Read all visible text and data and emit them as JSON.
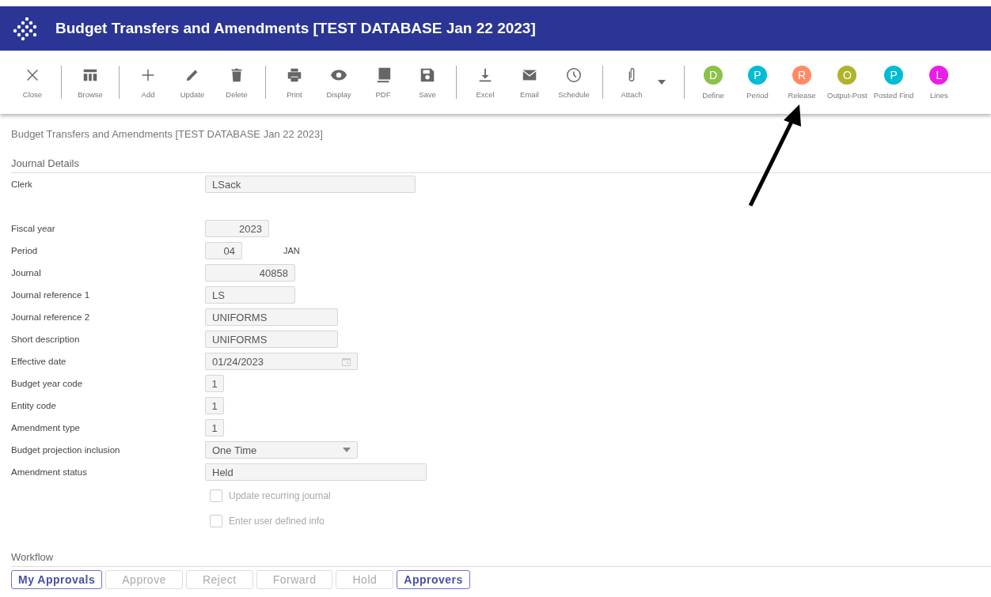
{
  "window": {
    "title": "Budget Transfers and Amendments [TEST DATABASE Jan 22 2023]"
  },
  "toolbar": [
    [
      {
        "kind": "close",
        "label": "Close"
      }
    ],
    [
      {
        "kind": "browse",
        "label": "Browse"
      }
    ],
    [
      {
        "kind": "add",
        "label": "Add"
      },
      {
        "kind": "update",
        "label": "Update"
      },
      {
        "kind": "delete",
        "label": "Delete"
      }
    ],
    [
      {
        "kind": "print",
        "label": "Print"
      },
      {
        "kind": "display",
        "label": "Display"
      },
      {
        "kind": "pdf",
        "label": "PDF"
      },
      {
        "kind": "save",
        "label": "Save"
      }
    ],
    [
      {
        "kind": "excel",
        "label": "Excel"
      },
      {
        "kind": "email",
        "label": "Email"
      },
      {
        "kind": "schedule",
        "label": "Schedule"
      }
    ],
    [
      {
        "kind": "attach",
        "label": "Attach",
        "dropdown": true
      }
    ],
    [
      {
        "kind": "letter",
        "letter": "D",
        "label": "Define",
        "color": "#8bc34a"
      },
      {
        "kind": "letter",
        "letter": "P",
        "label": "Period",
        "color": "#00bcd4"
      },
      {
        "kind": "letter",
        "letter": "R",
        "label": "Release",
        "color": "#ff8a65"
      },
      {
        "kind": "letter",
        "letter": "O",
        "label": "Output-Post",
        "color": "#afb42b"
      },
      {
        "kind": "letter",
        "letter": "P",
        "label": "Posted Find",
        "color": "#00bcd4"
      },
      {
        "kind": "letter",
        "letter": "L",
        "label": "Lines",
        "color": "#e91ee9"
      }
    ]
  ],
  "page_title": "Budget Transfers and Amendments [TEST DATABASE Jan 22 2023]",
  "section": "Journal Details",
  "fields": [
    {
      "label": "Clerk",
      "kind": "text",
      "value": "LSack"
    },
    {
      "label": "Fiscal year",
      "kind": "number",
      "value": "2023"
    },
    {
      "label": "Period",
      "kind": "number",
      "value": "04",
      "note": "JAN"
    },
    {
      "label": "Journal",
      "kind": "number",
      "value": "40858"
    },
    {
      "label": "Journal reference 1",
      "kind": "text",
      "value": "LS"
    },
    {
      "label": "Journal reference 2",
      "kind": "text",
      "value": "UNIFORMS"
    },
    {
      "label": "Short description",
      "kind": "text",
      "value": "UNIFORMS"
    },
    {
      "label": "Effective date",
      "kind": "date",
      "value": "01/24/2023"
    },
    {
      "label": "Budget year code",
      "kind": "code",
      "value": "1"
    },
    {
      "label": "Entity code",
      "kind": "code",
      "value": "1"
    },
    {
      "label": "Amendment type",
      "kind": "code",
      "value": "1"
    },
    {
      "label": "Budget projection inclusion",
      "kind": "select",
      "value": "One Time"
    },
    {
      "label": "Amendment status",
      "kind": "text",
      "value": "Held"
    }
  ],
  "checkboxes": [
    {
      "label": "Update recurring journal",
      "checked": false,
      "disabled": true
    },
    {
      "label": "Enter user defined info",
      "checked": false,
      "disabled": true
    }
  ],
  "workflow": {
    "title": "Workflow",
    "buttons": [
      {
        "label": "My Approvals",
        "disabled": false
      },
      {
        "label": "Approve",
        "disabled": true
      },
      {
        "label": "Reject",
        "disabled": true
      },
      {
        "label": "Forward",
        "disabled": true
      },
      {
        "label": "Hold",
        "disabled": true
      },
      {
        "label": "Approvers",
        "disabled": false
      }
    ]
  }
}
